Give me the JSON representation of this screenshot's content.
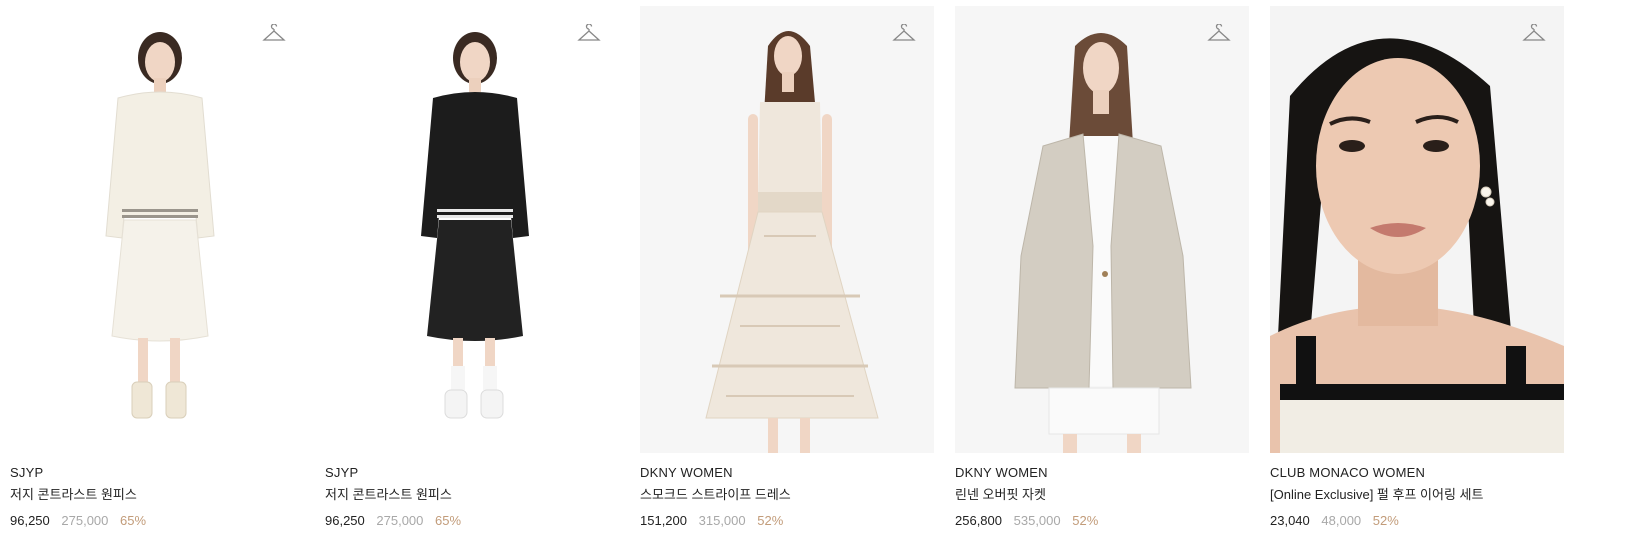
{
  "products": [
    {
      "brand": "SJYP",
      "name": "저지 콘트라스트 원피스",
      "price": "96,250",
      "original_price": "275,000",
      "discount": "65%",
      "image_desc": "model-white-sweatshirt-dress",
      "colors": {
        "top": "#f3efe4",
        "skirt": "#f5f2ea",
        "shoes": "#efe7d6"
      }
    },
    {
      "brand": "SJYP",
      "name": "저지 콘트라스트 원피스",
      "price": "96,250",
      "original_price": "275,000",
      "discount": "65%",
      "image_desc": "model-black-sweatshirt-dress",
      "colors": {
        "top": "#1c1c1c",
        "skirt": "#222222",
        "shoes": "#f4f4f4"
      }
    },
    {
      "brand": "DKNY WOMEN",
      "name": "스모크드 스트라이프 드레스",
      "price": "151,200",
      "original_price": "315,000",
      "discount": "52%",
      "image_desc": "model-striped-tiered-dress",
      "colors": {
        "dress": "#efe7dc",
        "stripe": "#d8c9b6"
      }
    },
    {
      "brand": "DKNY WOMEN",
      "name": "린넨 오버핏 자켓",
      "price": "256,800",
      "original_price": "535,000",
      "discount": "52%",
      "image_desc": "model-linen-blazer",
      "colors": {
        "jacket": "#d3cdc2",
        "inner": "#fafafa"
      }
    },
    {
      "brand": "CLUB MONACO WOMEN",
      "name": "[Online Exclusive] 펄 후프 이어링 세트",
      "price": "23,040",
      "original_price": "48,000",
      "discount": "52%",
      "image_desc": "model-closeup-pearl-earrings",
      "colors": {
        "skin": "#e9c3ac",
        "hair": "#161412",
        "top": "#111111",
        "knit": "#f1ede4"
      }
    }
  ],
  "icons": {
    "wishlist": "hanger-icon"
  }
}
